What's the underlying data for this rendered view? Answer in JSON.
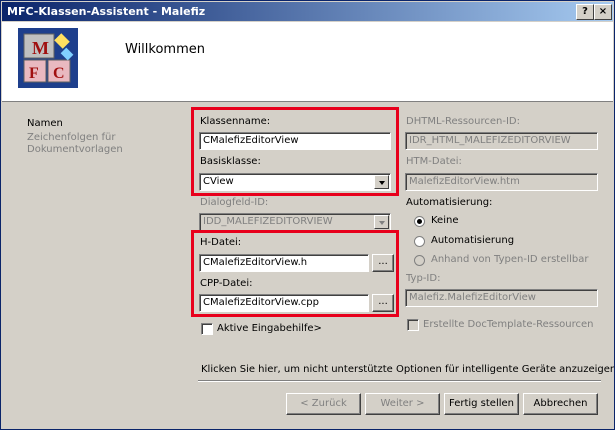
{
  "window": {
    "title": "MFC-Klassen-Assistent - Malefiz",
    "help_label": "?",
    "close_label": "×"
  },
  "header": {
    "title": "Willkommen",
    "logo_letters": [
      "M",
      "F",
      "C"
    ]
  },
  "sidebar": {
    "items": [
      {
        "label": "Namen",
        "active": true
      },
      {
        "label": "Zeichenfolgen für Dokumentvorlagen",
        "active": false
      }
    ]
  },
  "form": {
    "class_name_label": "Klassenname:",
    "class_name_value": "CMalefizEditorView",
    "base_class_label": "Basisklasse:",
    "base_class_value": "CView",
    "dialog_id_label": "Dialogfeld-ID:",
    "dialog_id_value": "IDD_MALEFIZEDITORVIEW",
    "h_file_label": "H-Datei:",
    "h_file_value": "CMalefizEditorView.h",
    "cpp_file_label": "CPP-Datei:",
    "cpp_file_value": "CMalefizEditorView.cpp",
    "browse_label": "...",
    "accessibility_label": "Aktive Eingabehilfe>",
    "dhtml_id_label": "DHTML-Ressourcen-ID:",
    "dhtml_id_value": "IDR_HTML_MALEFIZEDITORVIEW",
    "htm_file_label": "HTM-Datei:",
    "htm_file_value": "MalefizEditorView.htm",
    "automation_label": "Automatisierung:",
    "automation_options": [
      "Keine",
      "Automatisierung",
      "Anhand von Typen-ID erstellbar"
    ],
    "type_id_label": "Typ-ID:",
    "type_id_value": "Malefiz.MalefizEditorView",
    "doctemplate_label": "Erstellte DocTemplate-Ressourcen"
  },
  "footer": {
    "info_text": "Klicken Sie hier, um nicht unterstützte Optionen für intelligente Geräte anzuzeigen.",
    "back_label": "< Zurück",
    "next_label": "Weiter >",
    "finish_label": "Fertig stellen",
    "cancel_label": "Abbrechen"
  },
  "colors": {
    "highlight": "#e8001c",
    "title_start": "#0a246a",
    "title_end": "#a6caf0"
  }
}
